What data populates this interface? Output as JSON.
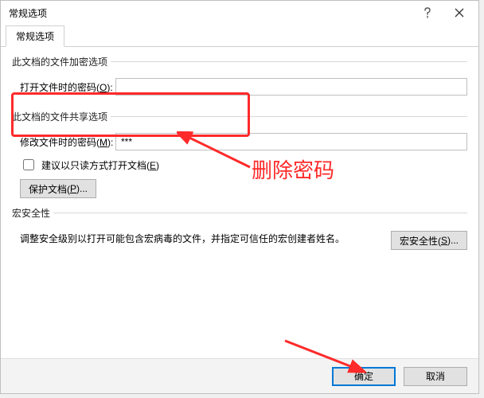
{
  "window": {
    "title": "常规选项"
  },
  "tabs": {
    "general": "常规选项"
  },
  "sections": {
    "encrypt": {
      "legend": "此文档的文件加密选项",
      "open_label": "打开文件时的密码(O):",
      "open_value": ""
    },
    "share": {
      "legend": "此文档的文件共享选项",
      "modify_label": "修改文件时的密码(M):",
      "modify_value": "***",
      "readonly_label": "建议以只读方式打开文档(E)",
      "protect_btn": "保护文档(P)..."
    },
    "macro": {
      "legend": "宏安全性",
      "desc": "调整安全级别以打开可能包含宏病毒的文件，并指定可信任的宏创建者姓名。",
      "btn": "宏安全性(S)..."
    }
  },
  "footer": {
    "ok": "确定",
    "cancel": "取消"
  },
  "annotation": {
    "label": "删除密码"
  }
}
